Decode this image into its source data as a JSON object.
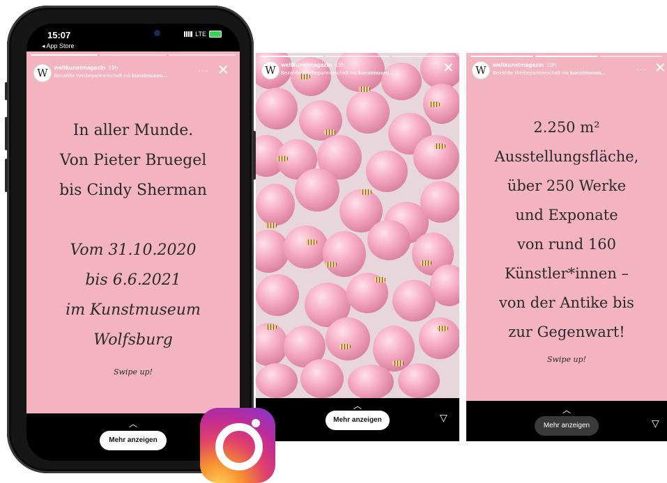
{
  "stories": [
    {
      "status": {
        "time": "15:07",
        "back": "◂ App Store",
        "network": "LTE"
      },
      "account": {
        "avatar": "W",
        "username": "weltkunstmagazin",
        "age": "19h",
        "sponsor_prefix": "Bezahlte Werbepartnerschaft mit ",
        "sponsor_partner": "kunstmuseu..."
      },
      "more": "···",
      "close": "✕",
      "headline": [
        "In aller Munde.",
        "Von Pieter Bruegel",
        "bis Cindy Sherman"
      ],
      "dates": [
        "Vom 31.10.2020",
        "bis 6.6.2021",
        "im Kunstmuseum",
        "Wolfsburg"
      ],
      "swipe": "Swipe up!",
      "chevron": "︿",
      "cta": "Mehr anzeigen"
    },
    {
      "account": {
        "avatar": "W",
        "username": "weltkunstmagazin",
        "age": "19h",
        "sponsor_prefix": "Bezahlte Werbepartnerschaft mit ",
        "sponsor_partner": "kunstmuseu..."
      },
      "close": "✕",
      "chevron": "︿",
      "cta": "Mehr anzeigen",
      "send": "▽"
    },
    {
      "account": {
        "avatar": "W",
        "username": "weltkunstmagazin",
        "age": "19h",
        "sponsor_prefix": "Bezahlte Werbepartnerschaft mit ",
        "sponsor_partner": "kunstmuseu..."
      },
      "more": "···",
      "close": "✕",
      "body": [
        "2.250 m²",
        "Ausstellungsfläche,",
        "über 250 Werke",
        "und Exponate",
        "von rund 160",
        "Künstler*innen –",
        "von der Antike bis",
        "zur Gegenwart!"
      ],
      "swipe": "Swipe up!",
      "chevron": "︿",
      "cta": "Mehr anzeigen",
      "send": "▽"
    }
  ],
  "colors": {
    "story_pink": "#f3b3c1",
    "phone_body": "#161616",
    "battery": "#39d353"
  },
  "logo": {
    "name": "instagram-logo"
  }
}
